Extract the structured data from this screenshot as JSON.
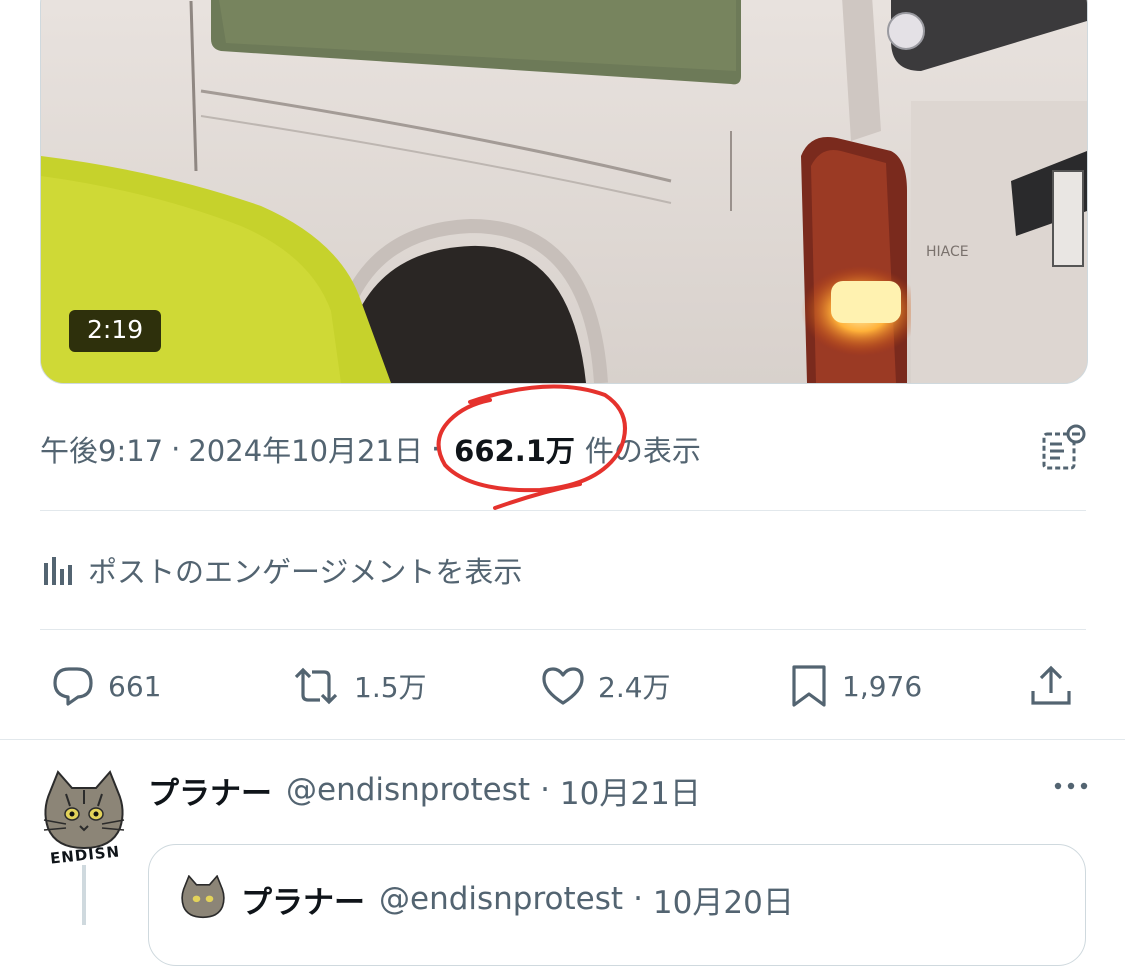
{
  "media": {
    "duration": "2:19"
  },
  "meta": {
    "time": "午後9:17",
    "separator": "·",
    "date": "2024年10月21日",
    "views": "662.1万",
    "views_suffix": "件の表示",
    "annotation_color": "#e5322d"
  },
  "engagement_link": "ポストのエンゲージメントを表示",
  "actions": {
    "reply_count": "661",
    "repost_count": "1.5万",
    "like_count": "2.4万",
    "bookmark_count": "1,976"
  },
  "reply": {
    "name": "プラナー",
    "handle": "@endisnprotest",
    "separator": "·",
    "date": "10月21日",
    "avatar_text": "ENDISN",
    "quote": {
      "name": "プラナー",
      "handle": "@endisnprotest",
      "separator": "·",
      "date": "10月20日"
    }
  },
  "colors": {
    "text": "#0f1419",
    "secondary": "#536471",
    "border": "#cfd9de"
  },
  "icons": [
    "reply-icon",
    "repost-icon",
    "like-icon",
    "bookmark-icon",
    "share-icon",
    "analytics-icon",
    "grok-icon",
    "more-icon"
  ]
}
